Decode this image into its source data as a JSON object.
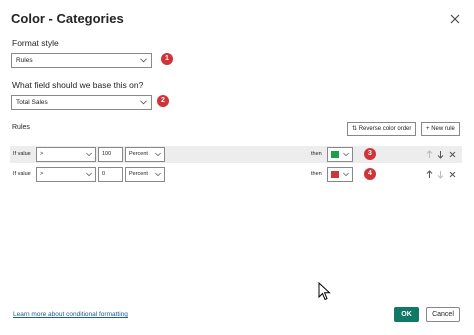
{
  "dialog": {
    "title": "Color - Categories"
  },
  "format_style": {
    "label": "Format style",
    "value": "Rules",
    "badge": "1"
  },
  "field": {
    "label": "What field should we base this on?",
    "value": "Total Sales",
    "badge": "2"
  },
  "rules": {
    "label": "Rules",
    "reverse_label": "Reverse color order",
    "new_rule_label": "New rule",
    "rows": [
      {
        "if_label": "If value",
        "operator": ">",
        "value": "100",
        "unit": "Percent",
        "then_label": "then",
        "color": "#1a9e47",
        "badge": "3"
      },
      {
        "if_label": "If value",
        "operator": ">",
        "value": "0",
        "unit": "Percent",
        "then_label": "then",
        "color": "#d13438",
        "badge": "4"
      }
    ]
  },
  "footer": {
    "learn_more": "Learn more about conditional formatting",
    "ok_label": "OK",
    "cancel_label": "Cancel"
  },
  "colors": {
    "accent": "#117865",
    "badge": "#d13438",
    "link": "#1d5aa1"
  }
}
